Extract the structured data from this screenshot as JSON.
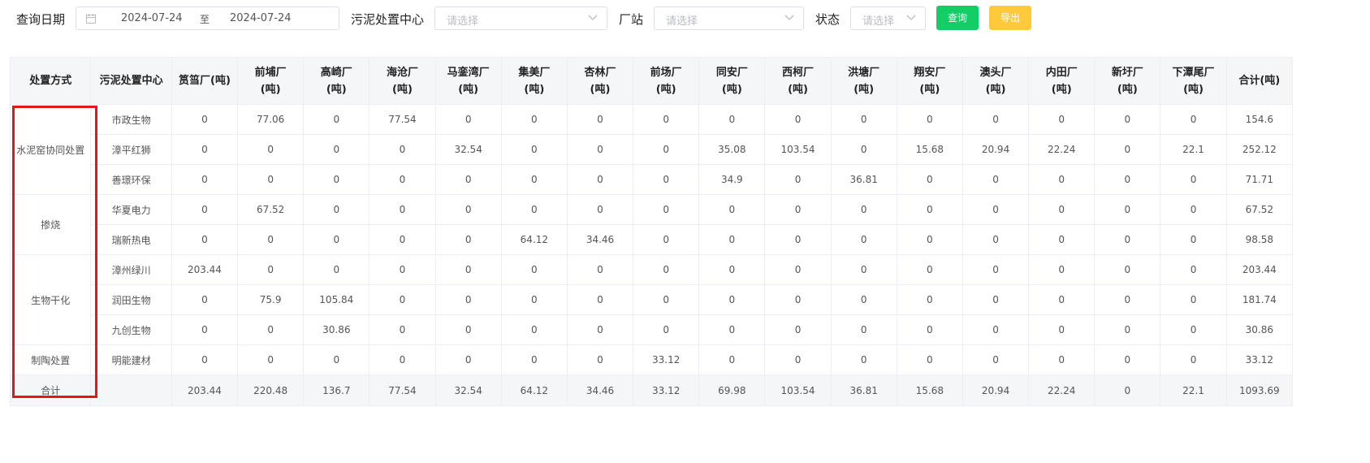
{
  "filters": {
    "query_date_label": "查询日期",
    "start_date": "2024-07-24",
    "range_separator": "至",
    "end_date": "2024-07-24",
    "center_label": "污泥处置中心",
    "center_placeholder": "请选择",
    "plant_label": "厂站",
    "plant_placeholder": "请选择",
    "status_label": "状态",
    "status_placeholder": "请选择",
    "query_button": "查询",
    "export_button": "导出"
  },
  "table": {
    "headers": {
      "method": "处置方式",
      "center": "污泥处置中心",
      "plants": [
        [
          "筼筜厂(吨)"
        ],
        [
          "前埔厂",
          "(吨)"
        ],
        [
          "高崎厂",
          "(吨)"
        ],
        [
          "海沧厂",
          "(吨)"
        ],
        [
          "马銮湾厂",
          "(吨)"
        ],
        [
          "集美厂",
          "(吨)"
        ],
        [
          "杏林厂",
          "(吨)"
        ],
        [
          "前场厂",
          "(吨)"
        ],
        [
          "同安厂",
          "(吨)"
        ],
        [
          "西柯厂",
          "(吨)"
        ],
        [
          "洪塘厂",
          "(吨)"
        ],
        [
          "翔安厂",
          "(吨)"
        ],
        [
          "澳头厂",
          "(吨)"
        ],
        [
          "内田厂",
          "(吨)"
        ],
        [
          "新圩厂",
          "(吨)"
        ],
        [
          "下潭尾厂",
          "(吨)"
        ]
      ],
      "total": "合计(吨)"
    },
    "groups": [
      {
        "method": "水泥窑协同处置",
        "rows": [
          {
            "center": "市政生物",
            "values": [
              "0",
              "77.06",
              "0",
              "77.54",
              "0",
              "0",
              "0",
              "0",
              "0",
              "0",
              "0",
              "0",
              "0",
              "0",
              "0",
              "0"
            ],
            "total": "154.6"
          },
          {
            "center": "漳平红狮",
            "values": [
              "0",
              "0",
              "0",
              "0",
              "32.54",
              "0",
              "0",
              "0",
              "35.08",
              "103.54",
              "0",
              "15.68",
              "20.94",
              "22.24",
              "0",
              "22.1"
            ],
            "total": "252.12"
          },
          {
            "center": "善璟环保",
            "values": [
              "0",
              "0",
              "0",
              "0",
              "0",
              "0",
              "0",
              "0",
              "34.9",
              "0",
              "36.81",
              "0",
              "0",
              "0",
              "0",
              "0"
            ],
            "total": "71.71"
          }
        ]
      },
      {
        "method": "掺烧",
        "rows": [
          {
            "center": "华夏电力",
            "values": [
              "0",
              "67.52",
              "0",
              "0",
              "0",
              "0",
              "0",
              "0",
              "0",
              "0",
              "0",
              "0",
              "0",
              "0",
              "0",
              "0"
            ],
            "total": "67.52"
          },
          {
            "center": "瑞新热电",
            "values": [
              "0",
              "0",
              "0",
              "0",
              "0",
              "64.12",
              "34.46",
              "0",
              "0",
              "0",
              "0",
              "0",
              "0",
              "0",
              "0",
              "0"
            ],
            "total": "98.58"
          }
        ]
      },
      {
        "method": "生物干化",
        "rows": [
          {
            "center": "漳州绿川",
            "values": [
              "203.44",
              "0",
              "0",
              "0",
              "0",
              "0",
              "0",
              "0",
              "0",
              "0",
              "0",
              "0",
              "0",
              "0",
              "0",
              "0"
            ],
            "total": "203.44"
          },
          {
            "center": "润田生物",
            "values": [
              "0",
              "75.9",
              "105.84",
              "0",
              "0",
              "0",
              "0",
              "0",
              "0",
              "0",
              "0",
              "0",
              "0",
              "0",
              "0",
              "0"
            ],
            "total": "181.74"
          },
          {
            "center": "九创生物",
            "values": [
              "0",
              "0",
              "30.86",
              "0",
              "0",
              "0",
              "0",
              "0",
              "0",
              "0",
              "0",
              "0",
              "0",
              "0",
              "0",
              "0"
            ],
            "total": "30.86"
          }
        ]
      },
      {
        "method": "制陶处置",
        "rows": [
          {
            "center": "明能建材",
            "values": [
              "0",
              "0",
              "0",
              "0",
              "0",
              "0",
              "0",
              "33.12",
              "0",
              "0",
              "0",
              "0",
              "0",
              "0",
              "0",
              "0"
            ],
            "total": "33.12"
          }
        ]
      }
    ],
    "totals": {
      "label": "合计",
      "values": [
        "203.44",
        "220.48",
        "136.7",
        "77.54",
        "32.54",
        "64.12",
        "34.46",
        "33.12",
        "69.98",
        "103.54",
        "36.81",
        "15.68",
        "20.94",
        "22.24",
        "0",
        "22.1"
      ],
      "total": "1093.69"
    }
  },
  "colors": {
    "highlight_box": "#e8141c",
    "query_button": "#13ce66",
    "export_button": "#ffc93c",
    "header_bg": "#f5f6f8"
  }
}
